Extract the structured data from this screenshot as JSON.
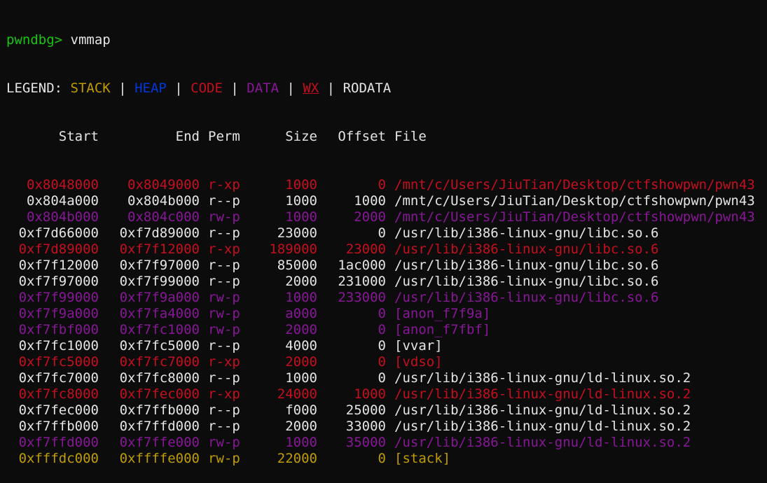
{
  "prompt": "pwndbg>",
  "command": "vmmap",
  "legend": {
    "label": "LEGEND:",
    "items": [
      {
        "text": "STACK",
        "color": "#c19c00"
      },
      {
        "text": "HEAP",
        "color": "#0037da"
      },
      {
        "text": "CODE",
        "color": "#c50f1f"
      },
      {
        "text": "DATA",
        "color": "#881798"
      },
      {
        "text": "WX",
        "color": "#c50f1f",
        "underline": true
      },
      {
        "text": "RODATA",
        "color": "#e5e5e5"
      }
    ],
    "separator": "|"
  },
  "columns": [
    "Start",
    "End",
    "Perm",
    "Size",
    "Offset",
    "File"
  ],
  "colors": {
    "code": "#c50f1f",
    "data": "#881798",
    "rodata": "#e5e5e5",
    "stack": "#c19c00",
    "prompt": "#16c60c"
  },
  "rows": [
    {
      "start": "0x8048000",
      "end": "0x8049000",
      "perm": "r-xp",
      "size": "1000",
      "offset": "0",
      "file": "/mnt/c/Users/JiuTian/Desktop/ctfshowpwn/pwn43",
      "kind": "code"
    },
    {
      "start": "0x804a000",
      "end": "0x804b000",
      "perm": "r--p",
      "size": "1000",
      "offset": "1000",
      "file": "/mnt/c/Users/JiuTian/Desktop/ctfshowpwn/pwn43",
      "kind": "rodata"
    },
    {
      "start": "0x804b000",
      "end": "0x804c000",
      "perm": "rw-p",
      "size": "1000",
      "offset": "2000",
      "file": "/mnt/c/Users/JiuTian/Desktop/ctfshowpwn/pwn43",
      "kind": "data"
    },
    {
      "start": "0xf7d66000",
      "end": "0xf7d89000",
      "perm": "r--p",
      "size": "23000",
      "offset": "0",
      "file": "/usr/lib/i386-linux-gnu/libc.so.6",
      "kind": "rodata"
    },
    {
      "start": "0xf7d89000",
      "end": "0xf7f12000",
      "perm": "r-xp",
      "size": "189000",
      "offset": "23000",
      "file": "/usr/lib/i386-linux-gnu/libc.so.6",
      "kind": "code"
    },
    {
      "start": "0xf7f12000",
      "end": "0xf7f97000",
      "perm": "r--p",
      "size": "85000",
      "offset": "1ac000",
      "file": "/usr/lib/i386-linux-gnu/libc.so.6",
      "kind": "rodata"
    },
    {
      "start": "0xf7f97000",
      "end": "0xf7f99000",
      "perm": "r--p",
      "size": "2000",
      "offset": "231000",
      "file": "/usr/lib/i386-linux-gnu/libc.so.6",
      "kind": "rodata"
    },
    {
      "start": "0xf7f99000",
      "end": "0xf7f9a000",
      "perm": "rw-p",
      "size": "1000",
      "offset": "233000",
      "file": "/usr/lib/i386-linux-gnu/libc.so.6",
      "kind": "data"
    },
    {
      "start": "0xf7f9a000",
      "end": "0xf7fa4000",
      "perm": "rw-p",
      "size": "a000",
      "offset": "0",
      "file": "[anon_f7f9a]",
      "kind": "data"
    },
    {
      "start": "0xf7fbf000",
      "end": "0xf7fc1000",
      "perm": "rw-p",
      "size": "2000",
      "offset": "0",
      "file": "[anon_f7fbf]",
      "kind": "data"
    },
    {
      "start": "0xf7fc1000",
      "end": "0xf7fc5000",
      "perm": "r--p",
      "size": "4000",
      "offset": "0",
      "file": "[vvar]",
      "kind": "rodata"
    },
    {
      "start": "0xf7fc5000",
      "end": "0xf7fc7000",
      "perm": "r-xp",
      "size": "2000",
      "offset": "0",
      "file": "[vdso]",
      "kind": "code"
    },
    {
      "start": "0xf7fc7000",
      "end": "0xf7fc8000",
      "perm": "r--p",
      "size": "1000",
      "offset": "0",
      "file": "/usr/lib/i386-linux-gnu/ld-linux.so.2",
      "kind": "rodata"
    },
    {
      "start": "0xf7fc8000",
      "end": "0xf7fec000",
      "perm": "r-xp",
      "size": "24000",
      "offset": "1000",
      "file": "/usr/lib/i386-linux-gnu/ld-linux.so.2",
      "kind": "code"
    },
    {
      "start": "0xf7fec000",
      "end": "0xf7ffb000",
      "perm": "r--p",
      "size": "f000",
      "offset": "25000",
      "file": "/usr/lib/i386-linux-gnu/ld-linux.so.2",
      "kind": "rodata"
    },
    {
      "start": "0xf7ffb000",
      "end": "0xf7ffd000",
      "perm": "r--p",
      "size": "2000",
      "offset": "33000",
      "file": "/usr/lib/i386-linux-gnu/ld-linux.so.2",
      "kind": "rodata"
    },
    {
      "start": "0xf7ffd000",
      "end": "0xf7ffe000",
      "perm": "rw-p",
      "size": "1000",
      "offset": "35000",
      "file": "/usr/lib/i386-linux-gnu/ld-linux.so.2",
      "kind": "data"
    },
    {
      "start": "0xfffdc000",
      "end": "0xffffe000",
      "perm": "rw-p",
      "size": "22000",
      "offset": "0",
      "file": "[stack]",
      "kind": "stack"
    }
  ]
}
